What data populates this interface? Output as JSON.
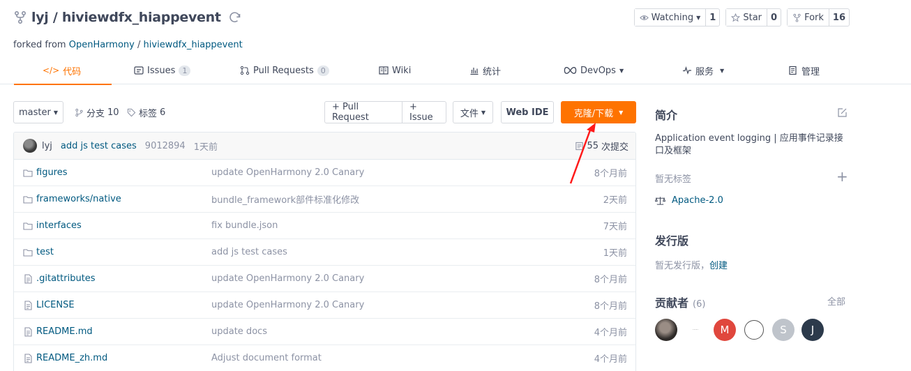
{
  "header": {
    "owner": "lyj",
    "separator": "/",
    "repo": "hiviewdfx_hiappevent",
    "forked_from_label": "forked from",
    "forked_from_org": "OpenHarmony",
    "forked_from_repo": "hiviewdfx_hiappevent"
  },
  "actions": {
    "watching_label": "Watching",
    "watching_count": "1",
    "star_label": "Star",
    "star_count": "0",
    "fork_label": "Fork",
    "fork_count": "16"
  },
  "tabs": [
    {
      "label": "代码",
      "badge": ""
    },
    {
      "label": "Issues",
      "badge": "1"
    },
    {
      "label": "Pull Requests",
      "badge": "0"
    },
    {
      "label": "Wiki",
      "badge": ""
    },
    {
      "label": "统计",
      "badge": ""
    },
    {
      "label": "DevOps",
      "badge": ""
    },
    {
      "label": "服务",
      "badge": ""
    },
    {
      "label": "管理",
      "badge": ""
    }
  ],
  "toolbar": {
    "branch": "master",
    "branches_label": "分支",
    "branches_count": "10",
    "tags_label": "标签",
    "tags_count": "6",
    "pull_request_button": "+ Pull Request",
    "issue_button": "+ Issue",
    "files_button": "文件",
    "web_ide_button": "Web IDE",
    "clone_button": "克隆/下载"
  },
  "last_commit": {
    "user": "lyj",
    "message": "add js test cases",
    "sha": "9012894",
    "when": "1天前",
    "count": "55",
    "count_suffix": "次提交"
  },
  "files": [
    {
      "type": "folder",
      "name_prefix": "figures",
      "name_suffix": "",
      "message": "update OpenHarmony 2.0 Canary",
      "age": "8个月前"
    },
    {
      "type": "folder",
      "name_prefix": "frameworks/",
      "name_suffix": "native",
      "message": "bundle_framework部件标准化修改",
      "age": "2天前"
    },
    {
      "type": "folder",
      "name_prefix": "interfaces",
      "name_suffix": "",
      "message": "fix bundle.json",
      "age": "7天前"
    },
    {
      "type": "folder",
      "name_prefix": "test",
      "name_suffix": "",
      "message": "add js test cases",
      "age": "1天前"
    },
    {
      "type": "file",
      "name_prefix": ".gitattributes",
      "name_suffix": "",
      "message": "update OpenHarmony 2.0 Canary",
      "age": "8个月前"
    },
    {
      "type": "file",
      "name_prefix": "LICENSE",
      "name_suffix": "",
      "message": "update OpenHarmony 2.0 Canary",
      "age": "8个月前"
    },
    {
      "type": "file",
      "name_prefix": "README.md",
      "name_suffix": "",
      "message": "update docs",
      "age": "4个月前"
    },
    {
      "type": "file",
      "name_prefix": "README_zh.md",
      "name_suffix": "",
      "message": "Adjust document format",
      "age": "4个月前"
    }
  ],
  "sidebar": {
    "intro_title": "简介",
    "description": "Application event logging | 应用事件记录接口及框架",
    "no_tags": "暂无标签",
    "license": "Apache-2.0",
    "releases_title": "发行版",
    "no_releases": "暂无发行版，",
    "create_link": "创建",
    "contributors_title": "贡献者",
    "contributors_count": "(6)",
    "all_link": "全部",
    "contributors": [
      {
        "initial": "",
        "color": "#3a3a3a"
      },
      {
        "initial": "",
        "color": "#ffffff"
      },
      {
        "initial": "M",
        "color": "#e0473d"
      },
      {
        "initial": "",
        "color": "#ffffff"
      },
      {
        "initial": "S",
        "color": "#bfc4cb"
      },
      {
        "initial": "J",
        "color": "#2c3a4b"
      }
    ]
  },
  "colors": {
    "accent": "#fe7300",
    "link": "#005980",
    "annotation": "#ff1a1a"
  }
}
